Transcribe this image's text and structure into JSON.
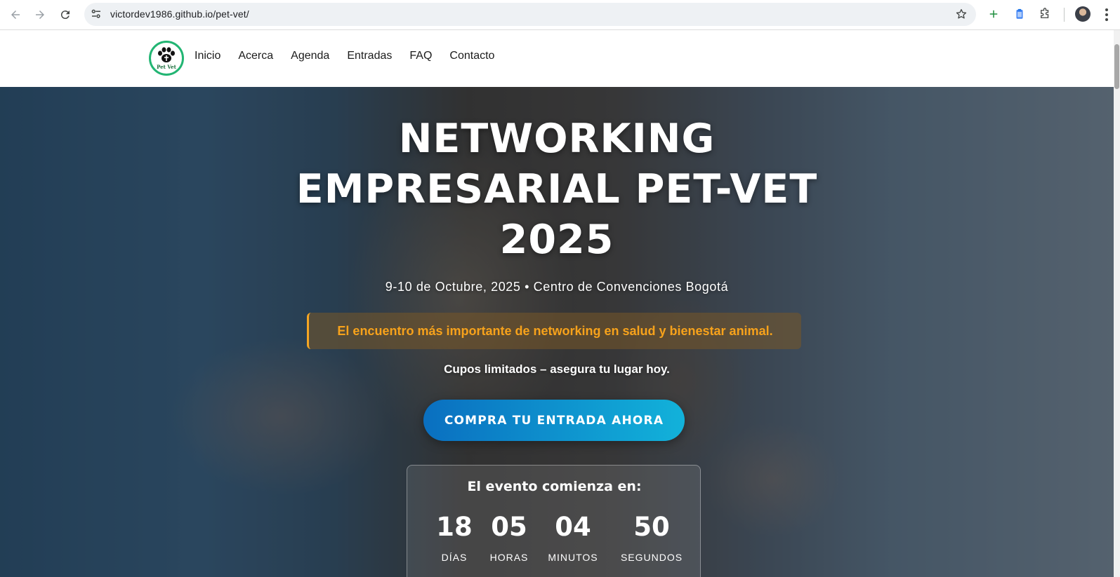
{
  "browser": {
    "url": "victordev1986.github.io/pet-vet/",
    "back_icon": "arrow-left-icon",
    "forward_icon": "arrow-right-icon",
    "reload_icon": "reload-icon",
    "site_settings_icon": "tune-icon",
    "bookmark_icon": "star-icon",
    "extensions": [
      "plus-extension-icon",
      "clipboard-extension-icon",
      "puzzle-extensions-icon"
    ],
    "profile_icon": "avatar",
    "menu_icon": "kebab-menu-icon"
  },
  "site": {
    "logo_text": "Pet Vet",
    "logo_icon": "paw-logo-icon",
    "nav": [
      "Inicio",
      "Acerca",
      "Agenda",
      "Entradas",
      "FAQ",
      "Contacto"
    ]
  },
  "hero": {
    "title_lines": [
      "NETWORKING",
      "EMPRESARIAL PET-VET",
      "2025"
    ],
    "date_location": "9-10 de Octubre, 2025 • Centro de Convenciones Bogotá",
    "tagline": "El encuentro más importante de networking en salud y bienestar animal.",
    "limited": "Cupos limitados – asegura tu lugar hoy.",
    "cta_label": "COMPRA TU ENTRADA AHORA"
  },
  "countdown": {
    "title": "El evento comienza en:",
    "units": [
      {
        "value": "18",
        "label": "DÍAS"
      },
      {
        "value": "05",
        "label": "HORAS"
      },
      {
        "value": "04",
        "label": "MINUTOS"
      },
      {
        "value": "50",
        "label": "SEGUNDOS"
      }
    ]
  },
  "colors": {
    "accent_orange": "#f7a21b",
    "cta_start": "#0a6fc0",
    "cta_end": "#12b2da",
    "logo_green": "#22b573"
  }
}
